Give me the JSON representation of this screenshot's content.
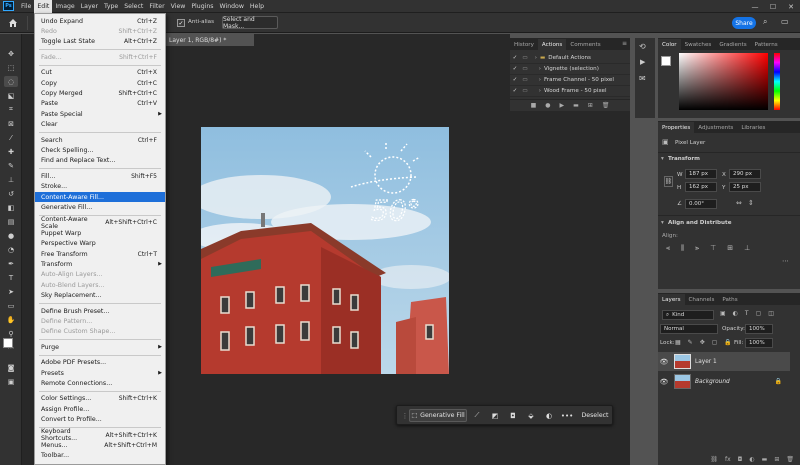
{
  "app": {
    "logo": "Ps"
  },
  "menubar": [
    "File",
    "Edit",
    "Image",
    "Layer",
    "Type",
    "Select",
    "Filter",
    "View",
    "Plugins",
    "Window",
    "Help"
  ],
  "window_controls": {
    "minimize": "—",
    "maximize": "☐",
    "close": "✕"
  },
  "options": {
    "anti_alias_label": "Anti-alias",
    "select_mask_label": "Select and Mask...",
    "share_label": "Share"
  },
  "doc_tab": "Layer 1, RGB/8#) *",
  "edit_menu": [
    {
      "label": "Undo Expand",
      "shortcut": "Ctrl+Z"
    },
    {
      "label": "Redo",
      "shortcut": "Shift+Ctrl+Z",
      "disabled": true
    },
    {
      "label": "Toggle Last State",
      "shortcut": "Alt+Ctrl+Z"
    },
    {
      "sep": true
    },
    {
      "label": "Fade...",
      "shortcut": "Shift+Ctrl+F",
      "disabled": true
    },
    {
      "sep": true
    },
    {
      "label": "Cut",
      "shortcut": "Ctrl+X"
    },
    {
      "label": "Copy",
      "shortcut": "Ctrl+C"
    },
    {
      "label": "Copy Merged",
      "shortcut": "Shift+Ctrl+C"
    },
    {
      "label": "Paste",
      "shortcut": "Ctrl+V"
    },
    {
      "label": "Paste Special",
      "shortcut": "",
      "submenu": true
    },
    {
      "label": "Clear",
      "shortcut": ""
    },
    {
      "sep": true
    },
    {
      "label": "Search",
      "shortcut": "Ctrl+F"
    },
    {
      "label": "Check Spelling...",
      "shortcut": ""
    },
    {
      "label": "Find and Replace Text...",
      "shortcut": ""
    },
    {
      "sep": true
    },
    {
      "label": "Fill...",
      "shortcut": "Shift+F5"
    },
    {
      "label": "Stroke...",
      "shortcut": ""
    },
    {
      "label": "Content-Aware Fill...",
      "shortcut": "",
      "highlighted": true
    },
    {
      "label": "Generative Fill...",
      "shortcut": ""
    },
    {
      "sep": true
    },
    {
      "label": "Content-Aware Scale",
      "shortcut": "Alt+Shift+Ctrl+C"
    },
    {
      "label": "Puppet Warp",
      "shortcut": ""
    },
    {
      "label": "Perspective Warp",
      "shortcut": ""
    },
    {
      "label": "Free Transform",
      "shortcut": "Ctrl+T"
    },
    {
      "label": "Transform",
      "shortcut": "",
      "submenu": true
    },
    {
      "label": "Auto-Align Layers...",
      "shortcut": "",
      "disabled": true
    },
    {
      "label": "Auto-Blend Layers...",
      "shortcut": "",
      "disabled": true
    },
    {
      "label": "Sky Replacement...",
      "shortcut": ""
    },
    {
      "sep": true
    },
    {
      "label": "Define Brush Preset...",
      "shortcut": ""
    },
    {
      "label": "Define Pattern...",
      "shortcut": "",
      "disabled": true
    },
    {
      "label": "Define Custom Shape...",
      "shortcut": "",
      "disabled": true
    },
    {
      "sep": true
    },
    {
      "label": "Purge",
      "shortcut": "",
      "submenu": true
    },
    {
      "sep": true
    },
    {
      "label": "Adobe PDF Presets...",
      "shortcut": ""
    },
    {
      "label": "Presets",
      "shortcut": "",
      "submenu": true
    },
    {
      "label": "Remote Connections...",
      "shortcut": ""
    },
    {
      "sep": true
    },
    {
      "label": "Color Settings...",
      "shortcut": "Shift+Ctrl+K"
    },
    {
      "label": "Assign Profile...",
      "shortcut": ""
    },
    {
      "label": "Convert to Profile...",
      "shortcut": ""
    },
    {
      "sep": true
    },
    {
      "label": "Keyboard Shortcuts...",
      "shortcut": "Alt+Shift+Ctrl+K"
    },
    {
      "label": "Menus...",
      "shortcut": "Alt+Shift+Ctrl+M"
    },
    {
      "label": "Toolbar...",
      "shortcut": ""
    }
  ],
  "history_panel": {
    "tabs": [
      "History",
      "Actions",
      "Comments"
    ],
    "active_tab": "Actions",
    "actions": [
      "Default Actions",
      "Vignette (selection)",
      "Frame Channel - 50 pixel",
      "Wood Frame - 50 pixel"
    ]
  },
  "color_panel": {
    "tabs": [
      "Color",
      "Swatches",
      "Gradients",
      "Patterns"
    ]
  },
  "properties_panel": {
    "tabs": [
      "Properties",
      "Adjustments",
      "Libraries"
    ],
    "type": "Pixel Layer",
    "transform_label": "Transform",
    "w": "187 px",
    "h": "162 px",
    "x": "290 px",
    "y": "25 px",
    "angle": "0.00°",
    "align_label": "Align and Distribute",
    "align_sub": "Align:"
  },
  "layers_panel": {
    "tabs": [
      "Layers",
      "Channels",
      "Paths"
    ],
    "kind": "Kind",
    "blend": "Normal",
    "opacity_label": "Opacity:",
    "opacity": "100%",
    "lock_label": "Lock:",
    "fill_label": "Fill:",
    "fill": "100%",
    "layers": [
      {
        "name": "Layer 1",
        "selected": true
      },
      {
        "name": "Background",
        "locked": true
      }
    ]
  },
  "context_bar": {
    "generative_fill": "Generative Fill",
    "deselect": "Deselect",
    "more": "•••"
  },
  "canvas_text": "50°",
  "colors": {
    "accent": "#1473e6",
    "menu_highlight": "#1e6fd9",
    "panel": "#323232",
    "canvas_bg": "#282828"
  }
}
